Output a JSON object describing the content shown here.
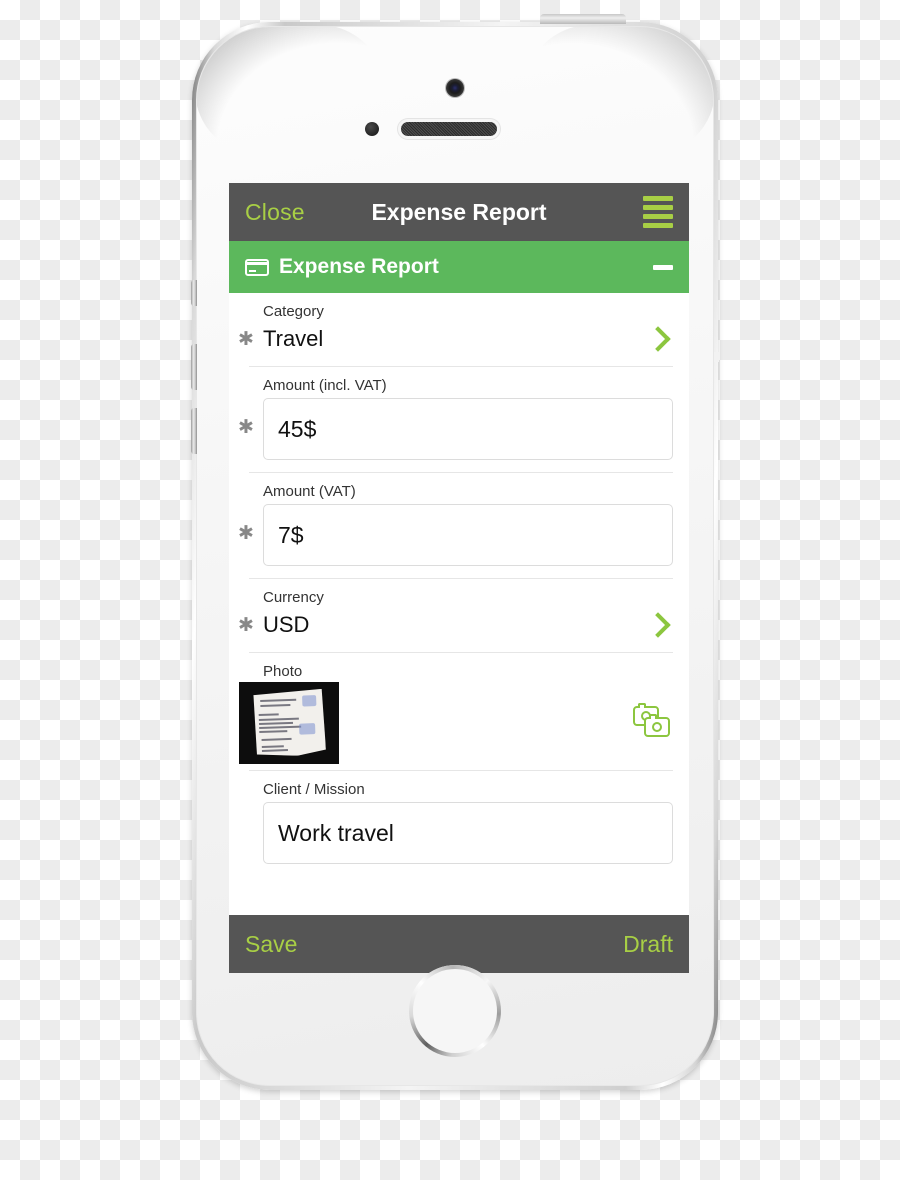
{
  "navbar": {
    "close_label": "Close",
    "title": "Expense Report",
    "menu_icon": "hamburger-menu-icon"
  },
  "section": {
    "icon": "credit-card-icon",
    "title": "Expense Report",
    "collapse_icon": "minus-icon"
  },
  "form": {
    "required_marker": "✱",
    "fields": [
      {
        "label": "Category",
        "value": "Travel",
        "type": "select",
        "accessory": "chevron-right-icon"
      },
      {
        "label": "Amount (incl. VAT)",
        "value": "45$",
        "type": "input"
      },
      {
        "label": "Amount (VAT)",
        "value": "7$",
        "type": "input"
      },
      {
        "label": "Currency",
        "value": "USD",
        "type": "select",
        "accessory": "chevron-right-icon"
      },
      {
        "label": "Photo",
        "value": "",
        "type": "photo",
        "accessory": "camera-icon"
      },
      {
        "label": "Client / Mission",
        "value": "Work travel",
        "type": "input"
      }
    ]
  },
  "toolbar": {
    "save_label": "Save",
    "draft_label": "Draft"
  },
  "colors": {
    "nav_background": "#555555",
    "accent_green": "#a8cf45",
    "section_green": "#5cb85c",
    "chevron_green": "#8cc63f",
    "text_dark": "#111111",
    "label_gray": "#333333",
    "required_gray": "#888888"
  },
  "device": {
    "camera": "front-camera",
    "speaker": "earpiece-speaker",
    "proximity": "proximity-sensor",
    "home": "home-button",
    "power": "power-button",
    "mute": "mute-switch",
    "volume_up": "volume-up-button",
    "volume_down": "volume-down-button"
  }
}
